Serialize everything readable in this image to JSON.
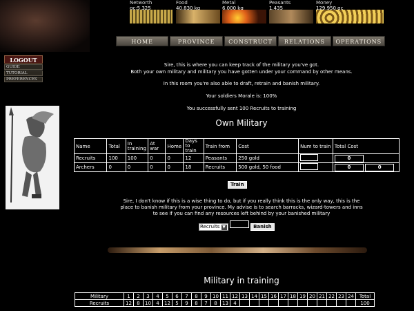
{
  "resources": [
    {
      "label": "Networth",
      "value": "gc:5,325",
      "icon": "coins-bars-icon"
    },
    {
      "label": "Food",
      "value": "40,830 kg",
      "icon": "wheat-icon"
    },
    {
      "label": "Metal",
      "value": "6,000 kg",
      "icon": "forge-fire-icon"
    },
    {
      "label": "Peasants",
      "value": "1,435",
      "icon": "peasants-icon"
    },
    {
      "label": "Money",
      "value": "129,950 gc",
      "icon": "gold-coins-icon"
    }
  ],
  "nav": [
    "HOME",
    "PROVINCE",
    "CONSTRUCT",
    "RELATIONS",
    "OPERATIONS"
  ],
  "menu": {
    "logout": "LOGOUT",
    "items": [
      "GUIDE",
      "TUTORIAL",
      "PREFERENCES"
    ]
  },
  "intro": {
    "line1": "Sire, this is where you can keep track of the military you've got.",
    "line2": "Both your own military and military you have gotten under your command by other means.",
    "line3": "In this room you're also able to draft, retrain and banish military.",
    "morale": "Your soldiers Morale is: 100%",
    "success": "You successfully sent 100 Recruits to training"
  },
  "own_military": {
    "title": "Own Military",
    "headers": [
      "Name",
      "Total",
      "In training",
      "At war",
      "Home",
      "Days to train",
      "Train from",
      "Cost",
      "Num to train",
      "Total Cost"
    ],
    "rows": [
      {
        "name": "Recruits",
        "total": "100",
        "in_training": "100",
        "at_war": "0",
        "home": "0",
        "days": "12",
        "from": "Peasants",
        "cost": "250 gold",
        "total_cost": [
          "0"
        ]
      },
      {
        "name": "Archers",
        "total": "0",
        "in_training": "0",
        "at_war": "0",
        "home": "0",
        "days": "18",
        "from": "Recruits",
        "cost": "500 gold, 50 food",
        "total_cost": [
          "0",
          "0"
        ]
      }
    ],
    "train_button": "Train"
  },
  "banish": {
    "line1": "Sire, I don't know if this is a wise thing to do, but if you really think this is the only way, this is the",
    "line2": "place to banish military from your province. My advise is to search barracks, wizard-towers and inns",
    "line3": "to see if you can find any resources left behind by your banished military",
    "select_value": "Recruits",
    "button": "Banish"
  },
  "training": {
    "title": "Military in training",
    "header_label": "Military",
    "columns": [
      "1",
      "2",
      "3",
      "4",
      "5",
      "6",
      "7",
      "8",
      "9",
      "10",
      "11",
      "12",
      "13",
      "14",
      "15",
      "16",
      "17",
      "18",
      "19",
      "20",
      "21",
      "22",
      "23",
      "24"
    ],
    "total_label": "Total",
    "rows": [
      {
        "name": "Recruits",
        "values": [
          "12",
          "8",
          "10",
          "4",
          "12",
          "5",
          "9",
          "8",
          "7",
          "8",
          "13",
          "4",
          "",
          "",
          "",
          "",
          "",
          "",
          "",
          "",
          "",
          "",
          "",
          ""
        ],
        "total": "100"
      }
    ]
  }
}
